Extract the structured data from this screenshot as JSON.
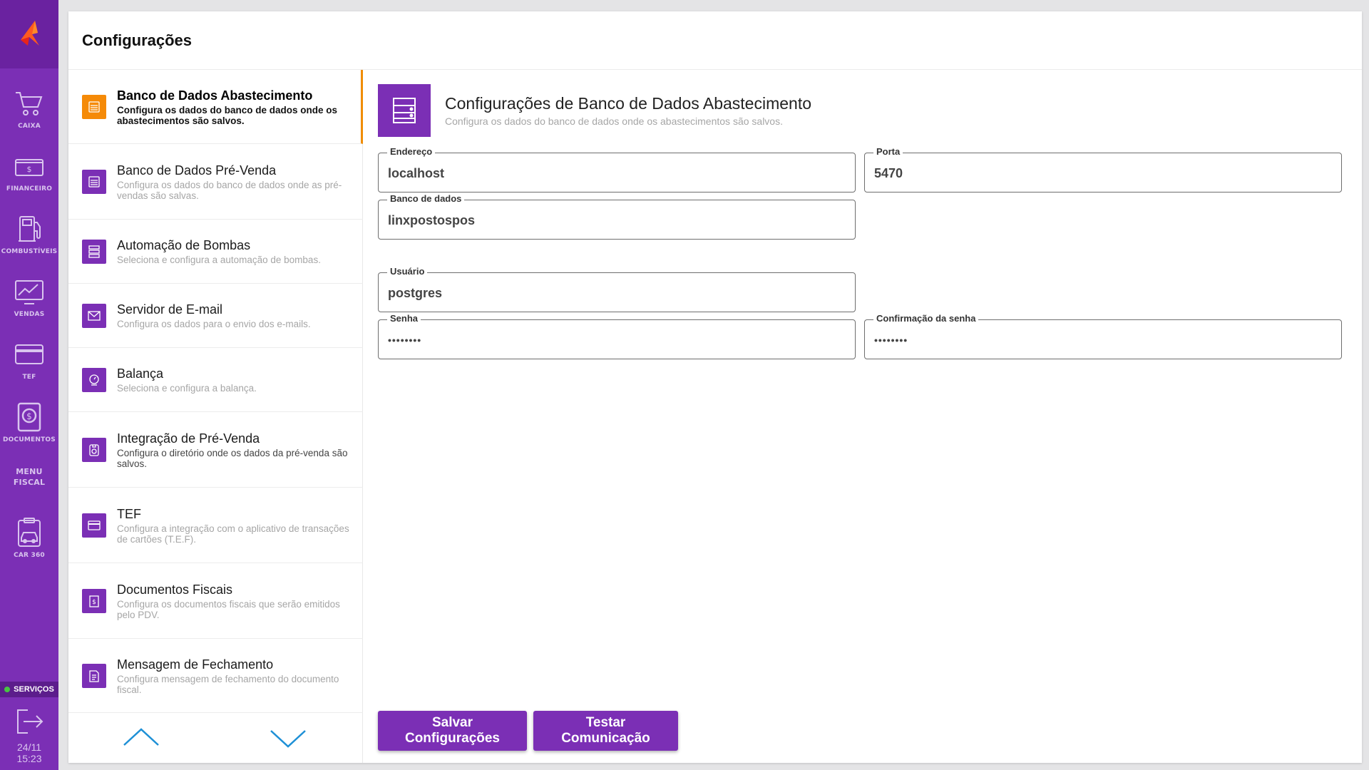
{
  "colors": {
    "accent": "#7b2fb5",
    "active": "#f58a07",
    "rail": "#7b2fb5",
    "status_ok": "#48c444"
  },
  "rail": {
    "logo_icon": "brand-logo-icon",
    "items": [
      {
        "label": "CAIXA",
        "icon": "cart-icon"
      },
      {
        "label": "FINANCEIRO",
        "icon": "money-icon"
      },
      {
        "label": "COMBUSTÍVEIS",
        "icon": "fuel-pump-icon"
      },
      {
        "label": "VENDAS",
        "icon": "sales-chart-icon"
      },
      {
        "label": "TEF",
        "icon": "card-icon"
      },
      {
        "label": "DOCUMENTOS",
        "icon": "documents-icon"
      },
      {
        "label": "MENU\nFISCAL"
      },
      {
        "label": "CAR 360",
        "icon": "car-360-icon"
      }
    ],
    "services_label": "SERVIÇOS",
    "exit_icon": "exit-icon",
    "date": "24/11",
    "time": "15:23"
  },
  "header": {
    "title": "Configurações"
  },
  "settings_list": [
    {
      "title": "Banco de Dados Abastecimento",
      "desc": "Configura os dados do banco de dados onde os abastecimentos são salvos.",
      "icon": "database-icon",
      "active": true
    },
    {
      "title": "Banco de Dados Pré-Venda",
      "desc": "Configura os dados do banco de dados onde as pré-vendas são salvas.",
      "icon": "database-icon"
    },
    {
      "title": "Automação de Bombas",
      "desc": "Seleciona e configura a automação de bombas.",
      "icon": "server-icon"
    },
    {
      "title": "Servidor de E-mail",
      "desc": "Configura os dados para o envio dos e-mails.",
      "icon": "mail-icon"
    },
    {
      "title": "Balança",
      "desc": "Seleciona e configura a balança.",
      "icon": "scale-icon"
    },
    {
      "title": "Integração de Pré-Venda",
      "desc": "Configura o diretório onde os dados da pré-venda são salvos.",
      "icon": "folder-sync-icon"
    },
    {
      "title": "TEF",
      "desc": "Configura a integração com o aplicativo de transações de cartões (T.E.F).",
      "icon": "card-icon"
    },
    {
      "title": "Documentos Fiscais",
      "desc": "Configura os documentos fiscais que serão emitidos pelo PDV.",
      "icon": "fiscal-doc-icon"
    },
    {
      "title": "Mensagem de Fechamento",
      "desc": "Configura mensagem de fechamento do documento fiscal.",
      "icon": "message-doc-icon"
    }
  ],
  "detail": {
    "title": "Configurações de Banco de Dados Abastecimento",
    "subtitle": "Configura os dados do banco de dados onde os abastecimentos são salvos.",
    "fields": {
      "endereco": {
        "label": "Endereço",
        "value": "localhost"
      },
      "porta": {
        "label": "Porta",
        "value": "5470"
      },
      "banco": {
        "label": "Banco de dados",
        "value": "linxpostospos"
      },
      "usuario": {
        "label": "Usuário",
        "value": "postgres"
      },
      "senha": {
        "label": "Senha",
        "value": "••••••••"
      },
      "confirmacao": {
        "label": "Confirmação da senha",
        "value": "••••••••"
      }
    },
    "buttons": {
      "save": "Salvar Configurações",
      "test": "Testar Comunicação"
    }
  }
}
